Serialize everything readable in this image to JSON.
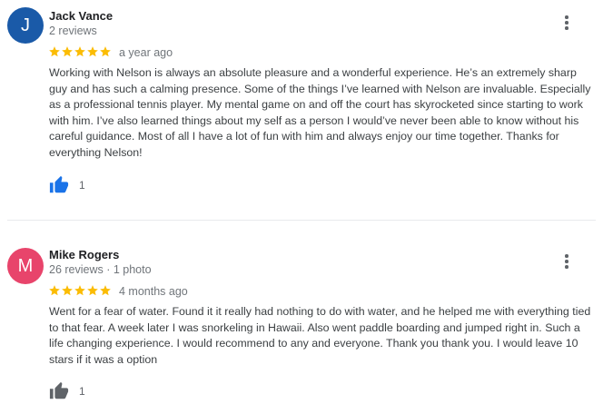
{
  "reviews": [
    {
      "avatar_letter": "J",
      "avatar_color": "#1a5aa8",
      "name": "Jack Vance",
      "meta": "2 reviews",
      "rating": 5,
      "when": "a year ago",
      "text": "Working with Nelson is always an absolute pleasure and a wonderful experience. He’s an extremely sharp guy and has such a calming presence. Some of the things I’ve learned with Nelson are invaluable. Especially as a professional tennis player. My mental game on and off the court has skyrocketed since starting to work with him. I’ve also learned things about my self as a person I would’ve never been able to know without his careful guidance. Most of all I have a lot of fun with him and always enjoy our time together.  Thanks for everything Nelson!",
      "likes": "1",
      "liked": true
    },
    {
      "avatar_letter": "M",
      "avatar_color": "#e8446b",
      "name": "Mike Rogers",
      "meta": "26 reviews · 1 photo",
      "rating": 5,
      "when": "4 months ago",
      "text": "Went for a fear of water. Found it it really had nothing to do with water, and he helped me with everything tied to that fear. A week later  I was snorkeling in Hawaii. Also went paddle boarding and jumped right in. Such a life changing experience. I would recommend to any and everyone. Thank you thank you. I would leave 10 stars if it was a option",
      "likes": "1",
      "liked": false
    }
  ],
  "colors": {
    "star": "#fbbc04",
    "like_active": "#1a73e8",
    "like_inactive": "#5f6368"
  }
}
